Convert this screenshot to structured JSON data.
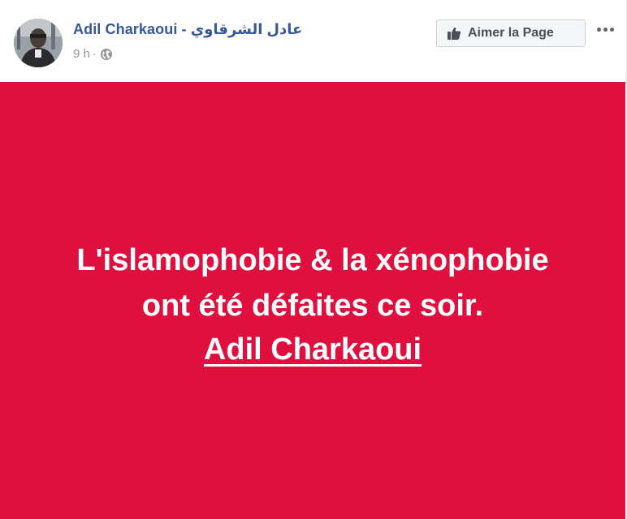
{
  "post": {
    "author_name": "Adil Charkaoui - عادل الشرقاوي",
    "timestamp": "9 h",
    "separator": "·",
    "privacy_icon": "globe-icon",
    "like_page_label": "Aimer la Page",
    "like_icon": "thumbs-up-icon",
    "more_icon": "more-options-icon"
  },
  "banner": {
    "background_color": "#df0f3e",
    "line1": "L'islamophobie & la xénophobie",
    "line2": "ont été défaites ce soir.",
    "line3": "Adil Charkaoui"
  },
  "colors": {
    "author_link": "#365899",
    "meta_text": "#90949c"
  }
}
